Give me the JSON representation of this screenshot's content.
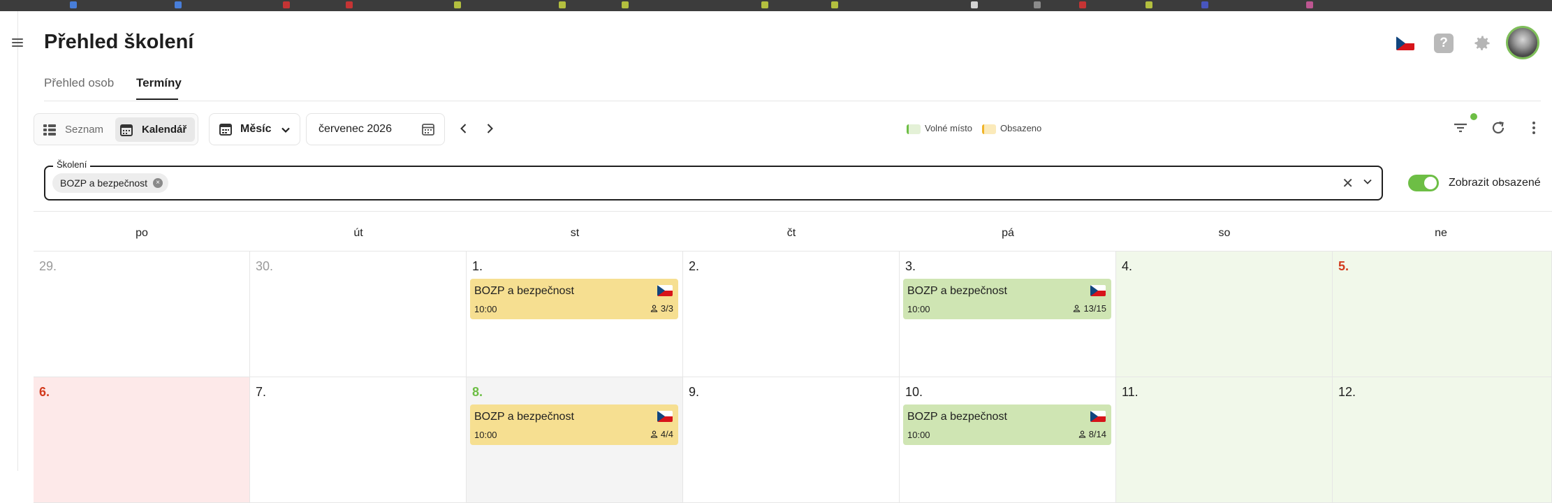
{
  "header": {
    "title": "Přehled školení",
    "language_icon": "czech-flag-icon",
    "help_label": "?",
    "settings_icon": "gear-icon",
    "avatar_icon": "user-avatar"
  },
  "tabs": [
    {
      "label": "Přehled osob",
      "active": false
    },
    {
      "label": "Termíny",
      "active": true
    }
  ],
  "toolbar": {
    "view_toggle": [
      {
        "label": "Seznam",
        "icon": "list-icon",
        "selected": false
      },
      {
        "label": "Kalendář",
        "icon": "calendar-icon",
        "selected": true
      }
    ],
    "period_select": {
      "label": "Měsíc",
      "icon": "calendar-grid-icon"
    },
    "date_field": {
      "value": "červenec 2026",
      "icon": "calendar-icon"
    },
    "prev_icon": "chevron-left-icon",
    "next_icon": "chevron-right-icon",
    "legend": [
      {
        "label": "Volné místo",
        "color": "#e4f1d7",
        "edge": "#6dbe45"
      },
      {
        "label": "Obsazeno",
        "color": "#fbeaba",
        "edge": "#f0b429"
      }
    ],
    "filter_icon": "filter-icon",
    "refresh_icon": "refresh-icon",
    "more_icon": "more-vertical-icon"
  },
  "training_picker": {
    "label": "Školení",
    "chips": [
      "BOZP a bezpečnost"
    ]
  },
  "show_full_toggle": {
    "label": "Zobrazit obsazené",
    "on": true
  },
  "calendar": {
    "weekdays": [
      "po",
      "út",
      "st",
      "čt",
      "pá",
      "so",
      "ne"
    ],
    "weeks": [
      [
        {
          "day": "29.",
          "muted": true,
          "bg": "#ffffff",
          "color": "#9a9a9a"
        },
        {
          "day": "30.",
          "muted": true,
          "bg": "#ffffff",
          "color": "#9a9a9a"
        },
        {
          "day": "1.",
          "bg": "#ffffff",
          "color": "#1f1f1f",
          "event": {
            "name": "BOZP a bezpečnost",
            "time": "10:00",
            "capacity": "3/3",
            "status": "full"
          }
        },
        {
          "day": "2.",
          "bg": "#ffffff",
          "color": "#1f1f1f"
        },
        {
          "day": "3.",
          "bg": "#ffffff",
          "color": "#1f1f1f",
          "event": {
            "name": "BOZP a bezpečnost",
            "time": "10:00",
            "capacity": "13/15",
            "status": "free"
          }
        },
        {
          "day": "4.",
          "bg": "#f1f8ea",
          "color": "#1f1f1f"
        },
        {
          "day": "5.",
          "bg": "#f1f8ea",
          "color": "#d23a1d",
          "bold": true
        }
      ],
      [
        {
          "day": "6.",
          "bg": "#fde9e9",
          "color": "#d23a1d",
          "bold": true
        },
        {
          "day": "7.",
          "bg": "#ffffff",
          "color": "#1f1f1f"
        },
        {
          "day": "8.",
          "bg": "#f4f4f4",
          "color": "#6dbe45",
          "bold": true,
          "event": {
            "name": "BOZP a bezpečnost",
            "time": "10:00",
            "capacity": "4/4",
            "status": "full"
          }
        },
        {
          "day": "9.",
          "bg": "#ffffff",
          "color": "#1f1f1f"
        },
        {
          "day": "10.",
          "bg": "#ffffff",
          "color": "#1f1f1f",
          "event": {
            "name": "BOZP a bezpečnost",
            "time": "10:00",
            "capacity": "8/14",
            "status": "free"
          }
        },
        {
          "day": "11.",
          "bg": "#f1f8ea",
          "color": "#1f1f1f"
        },
        {
          "day": "12.",
          "bg": "#f1f8ea",
          "color": "#1f1f1f"
        }
      ]
    ]
  }
}
